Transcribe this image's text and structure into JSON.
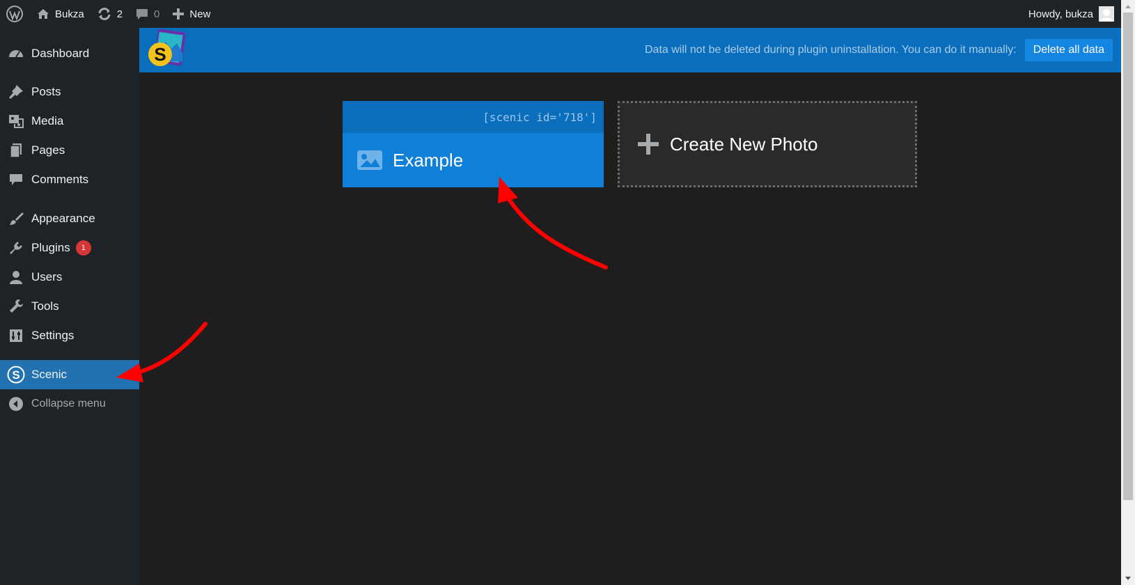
{
  "admin_bar": {
    "site_name": "Bukza",
    "updates_count": "2",
    "comments_count": "0",
    "new_label": "New",
    "greeting": "Howdy, bukza"
  },
  "sidebar": {
    "items": [
      {
        "label": "Dashboard",
        "icon": "dashboard-icon"
      },
      {
        "label": "Posts",
        "icon": "pin-icon"
      },
      {
        "label": "Media",
        "icon": "media-icon"
      },
      {
        "label": "Pages",
        "icon": "pages-icon"
      },
      {
        "label": "Comments",
        "icon": "comment-icon"
      },
      {
        "label": "Appearance",
        "icon": "brush-icon"
      },
      {
        "label": "Plugins",
        "icon": "plug-icon",
        "badge": "1"
      },
      {
        "label": "Users",
        "icon": "user-icon"
      },
      {
        "label": "Tools",
        "icon": "wrench-icon"
      },
      {
        "label": "Settings",
        "icon": "sliders-icon"
      },
      {
        "label": "Scenic",
        "icon": "scenic-icon",
        "active": true
      },
      {
        "label": "Collapse menu",
        "icon": "collapse-icon"
      }
    ]
  },
  "header": {
    "notice": "Data will not be deleted during plugin uninstallation. You can do it manually:",
    "delete_button": "Delete all data"
  },
  "cards": {
    "example": {
      "shortcode": "[scenic id='718']",
      "title": "Example"
    },
    "create": {
      "label": "Create New Photo"
    }
  },
  "colors": {
    "admin_bg": "#1d2327",
    "accent": "#2271b1",
    "header_blue": "#0a6ebd",
    "card_blue": "#0f7fd8",
    "badge_red": "#d63638",
    "arrow_red": "#ff0000"
  }
}
